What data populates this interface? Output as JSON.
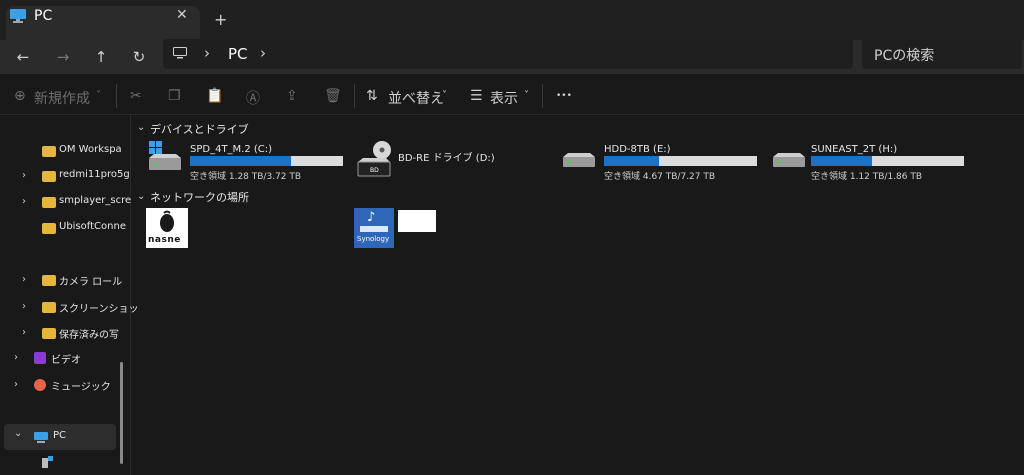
{
  "tab": {
    "title": "PC",
    "close": "✕",
    "new_tab": "+"
  },
  "nav": {
    "back": "←",
    "forward": "→",
    "up": "↑",
    "refresh": "↻",
    "sep": "›"
  },
  "address": {
    "location": "PC"
  },
  "search": {
    "placeholder": "PCの検索"
  },
  "toolbar": {
    "new_label": "新規作成",
    "sort_label": "並べ替え",
    "view_label": "表示",
    "more": "•••"
  },
  "sidebar": {
    "items": [
      {
        "label": "OM Workspa",
        "chevron": ""
      },
      {
        "label": "redmi11pro5g",
        "chevron": "›"
      },
      {
        "label": "smplayer_scre",
        "chevron": "›"
      },
      {
        "label": "UbisoftConne",
        "chevron": ""
      },
      {
        "label": "カメラ ロール",
        "chevron": "›"
      },
      {
        "label": "スクリーンショッ",
        "chevron": "›"
      },
      {
        "label": "保存済みの写",
        "chevron": "›"
      },
      {
        "label": "ビデオ",
        "chevron": "›"
      },
      {
        "label": "ミュージック",
        "chevron": "›"
      },
      {
        "label": "PC",
        "chevron": "⌄"
      }
    ]
  },
  "sections": {
    "devices": {
      "title": "デバイスとドライブ",
      "chevron": "⌄"
    },
    "network": {
      "title": "ネットワークの場所",
      "chevron": "⌄"
    }
  },
  "drives": [
    {
      "name": "SPD_4T_M.2 (C:)",
      "space": "空き領域 1.28 TB/3.72 TB",
      "used_fraction": 0.66,
      "icon": "windows-drive-icon"
    },
    {
      "name": "BD-RE ドライブ (D:)",
      "space": "",
      "icon": "bd-drive-icon",
      "badge": "BD"
    },
    {
      "name": "HDD-8TB (E:)",
      "space": "空き領域 4.67 TB/7.27 TB",
      "used_fraction": 0.36,
      "icon": "hdd-icon"
    },
    {
      "name": "SUNEAST_2T (H:)",
      "space": "空き領域 1.12 TB/1.86 TB",
      "used_fraction": 0.4,
      "icon": "hdd-icon"
    }
  ],
  "network": [
    {
      "logo_text": "nasne",
      "icon": "nasne-icon"
    },
    {
      "logo_text": "Synology",
      "icon": "synology-icon"
    }
  ],
  "colors": {
    "accent": "#1a73c9",
    "folder": "#e8b53c",
    "background": "#191919"
  }
}
